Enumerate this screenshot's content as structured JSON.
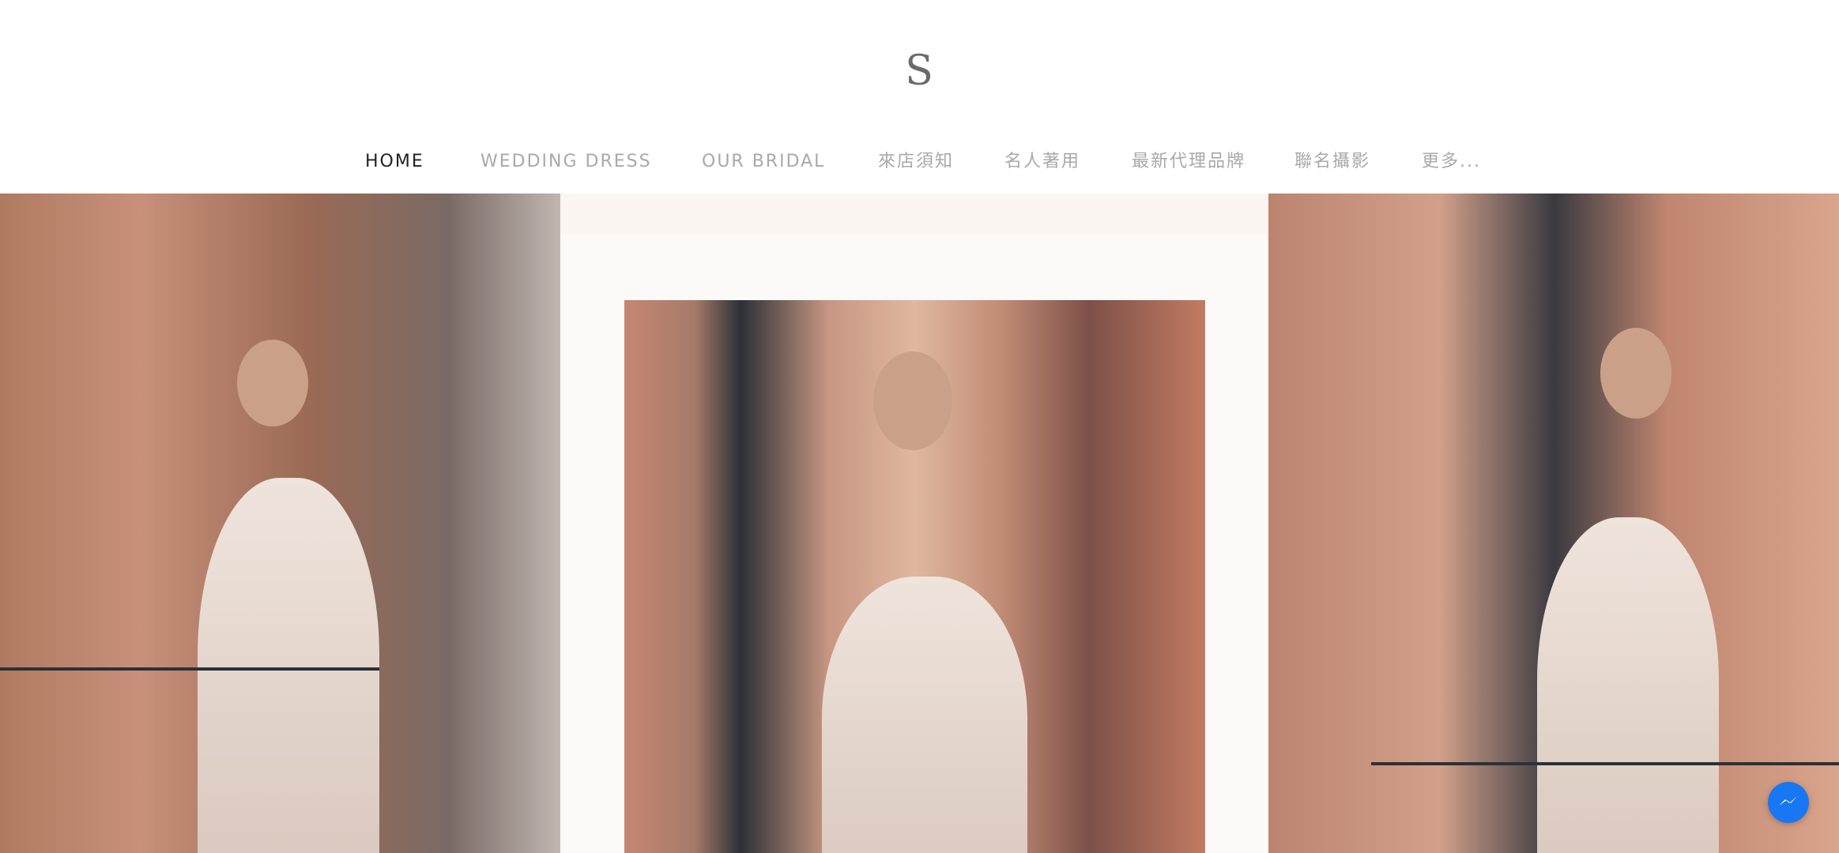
{
  "logo": {
    "text": "S"
  },
  "nav": {
    "items": [
      {
        "label": "HOME",
        "active": true
      },
      {
        "label": "WEDDING DRESS",
        "active": false
      },
      {
        "label": "OUR BRIDAL",
        "active": false
      },
      {
        "label": "來店須知",
        "active": false
      },
      {
        "label": "名人著用",
        "active": false
      },
      {
        "label": "最新代理品牌",
        "active": false
      },
      {
        "label": "聯名攝影",
        "active": false
      },
      {
        "label": "更多...",
        "active": false
      }
    ]
  },
  "gallery": {
    "images": [
      {
        "name": "bridal-photo-back-view"
      },
      {
        "name": "bridal-photo-front-view"
      },
      {
        "name": "bridal-photo-side-view"
      }
    ]
  },
  "widgets": {
    "chat_icon": "messenger-icon",
    "chat_color": "#1877f2"
  }
}
